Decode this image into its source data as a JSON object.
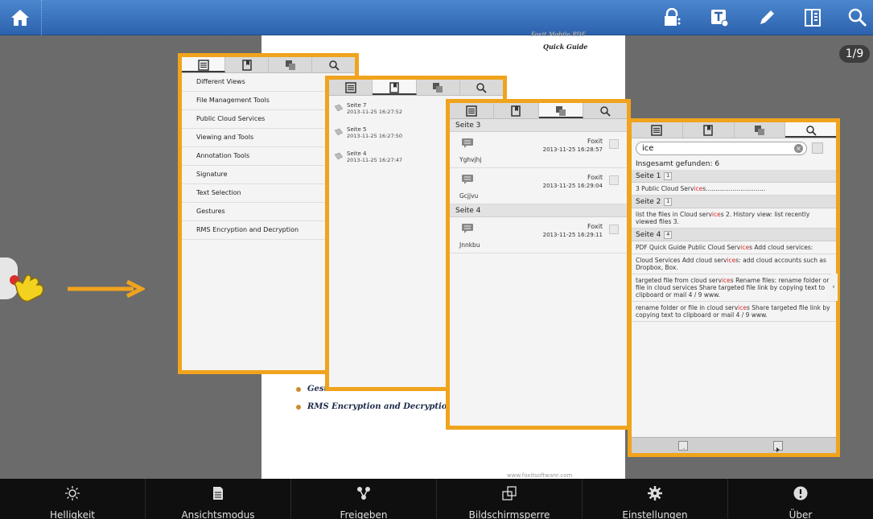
{
  "topbar": {
    "icons": [
      "home-icon",
      "lock-share-icon",
      "text-tool-icon",
      "pen-icon",
      "reading-mode-icon",
      "search-icon"
    ]
  },
  "page": {
    "header_line1": "Foxit Mobile PDF",
    "header_line2": "Quick Guide",
    "counter": "1/9",
    "bullet1": "Gestu",
    "bullet2": "RMS Encryption and Decryption....",
    "footer": "www.foxitsoftware.com"
  },
  "panel_outline": {
    "items": [
      "Different Views",
      "File Management Tools",
      "Public Cloud Services",
      "Viewing and Tools",
      "Annotation Tools",
      "Signature",
      "Text Selection",
      "Gestures",
      "RMS Encryption and Decryption"
    ]
  },
  "panel_bookmarks": {
    "items": [
      {
        "title": "Seite 7",
        "date": "2013-11-25 16:27:52"
      },
      {
        "title": "Seite 5",
        "date": "2013-11-25 16:27:50"
      },
      {
        "title": "Seite 4",
        "date": "2013-11-25 16:27:47"
      }
    ]
  },
  "panel_annotations": {
    "sections": [
      {
        "title": "Seite 3",
        "items": [
          {
            "author": "Foxit",
            "date": "2013-11-25 16:28:57",
            "text": "Yghvjhj"
          },
          {
            "author": "Foxit",
            "date": "2013-11-25 16:29:04",
            "text": "Gcjjvu"
          }
        ]
      },
      {
        "title": "Seite 4",
        "items": [
          {
            "author": "Foxit",
            "date": "2013-11-25 16:29:11",
            "text": "Jnnkbu"
          }
        ]
      }
    ]
  },
  "panel_search": {
    "query": "ice",
    "total": "Insgesamt gefunden: 6",
    "groups": [
      {
        "title": "Seite 1",
        "count": "1",
        "results": [
          {
            "pre": "3  Public Cloud Serv",
            "hit": "ice",
            "post": "s..............................."
          }
        ]
      },
      {
        "title": "Seite 2",
        "count": "1",
        "results": [
          {
            "pre": "list the files in Cloud serv",
            "hit": "ice",
            "post": "s  2. History view: list recently viewed files  3."
          }
        ]
      },
      {
        "title": "Seite 4",
        "count": "4",
        "results": [
          {
            "pre": "PDF  Quick Guide  Public Cloud Serv",
            "hit": "ice",
            "post": "s  Add cloud services:"
          },
          {
            "pre": "Cloud Services  Add cloud serv",
            "hit": "ice",
            "post": "s:  add cloud accounts such as Dropbox, Box."
          },
          {
            "pre": "targeted file from cloud serv",
            "hit": "ice",
            "post": "s  Rename files: rename folder or file in cloud services  Share targeted file link by copying text to clipboard or mail   4 / 9 www."
          },
          {
            "pre": "rename folder or file in cloud serv",
            "hit": "ice",
            "post": "s  Share targeted file link by copying text to clipboard or mail   4 / 9 www."
          }
        ]
      }
    ]
  },
  "bottombar": {
    "items": [
      {
        "label": "Helligkeit",
        "icon": "brightness-icon"
      },
      {
        "label": "Ansichtsmodus",
        "icon": "view-mode-icon"
      },
      {
        "label": "Freigeben",
        "icon": "share-icon"
      },
      {
        "label": "Bildschirmsperre",
        "icon": "screen-lock-icon"
      },
      {
        "label": "Einstellungen",
        "icon": "gear-icon"
      },
      {
        "label": "Über",
        "icon": "info-icon"
      }
    ]
  },
  "colors": {
    "accent_border": "#f0a31c",
    "topbar": "#3a72be",
    "highlight": "#e02a2a"
  }
}
